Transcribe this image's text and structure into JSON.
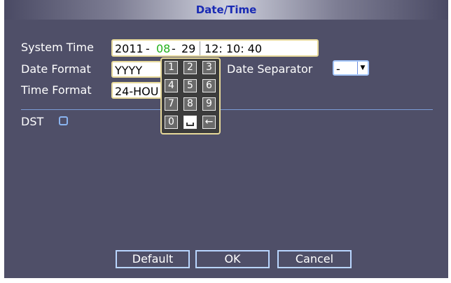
{
  "dialog": {
    "title": "Date/Time"
  },
  "system_time": {
    "label": "System Time",
    "year": "2011",
    "sep1": "-",
    "month": "08",
    "sep2": "-",
    "day": "29",
    "time": "12: 10: 40"
  },
  "date_format": {
    "label": "Date Format",
    "value": "YYYY"
  },
  "date_separator": {
    "label": "Date Separator",
    "value": "-"
  },
  "time_format": {
    "label": "Time Format",
    "value": "24-HOU"
  },
  "dst": {
    "label": "DST",
    "checked": false
  },
  "keypad": {
    "keys": [
      "1",
      "2",
      "3",
      "4",
      "5",
      "6",
      "7",
      "8",
      "9",
      "0",
      "␣",
      "←"
    ]
  },
  "buttons": {
    "default": "Default",
    "ok": "OK",
    "cancel": "Cancel"
  }
}
